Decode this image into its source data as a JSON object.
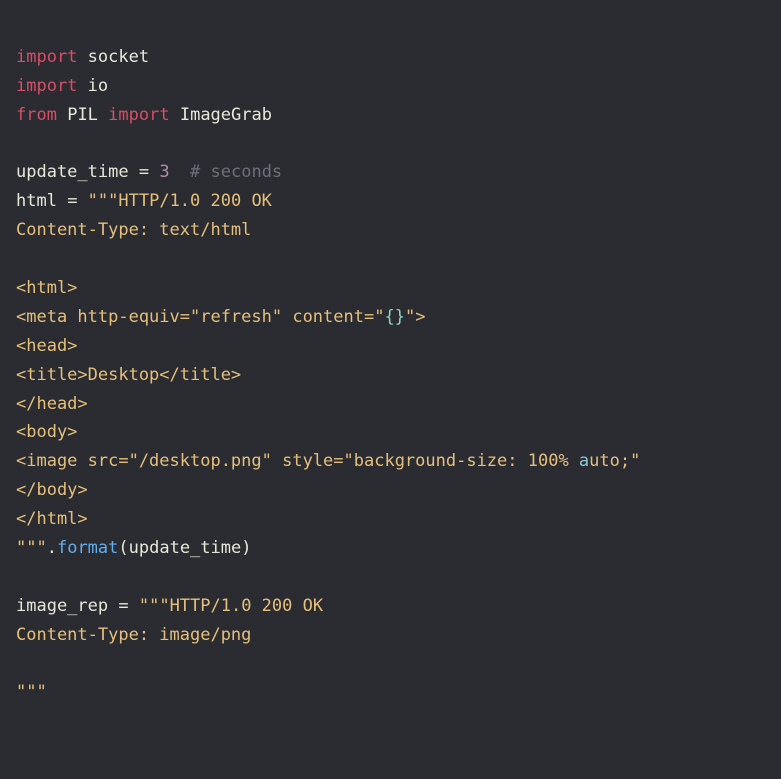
{
  "lines": {
    "l1_kw1": "import",
    "l1_mod": "socket",
    "l2_kw1": "import",
    "l2_mod": "io",
    "l3_kw1": "from",
    "l3_mod": "PIL",
    "l3_kw2": "import",
    "l3_cls": "ImageGrab",
    "l5_var": "update_time",
    "l5_eq": " = ",
    "l5_num": "3",
    "l5_sp": "  ",
    "l5_cm": "# seconds",
    "l6_var": "html",
    "l6_eq": " = ",
    "l6_str_open": "\"\"\"",
    "l6_rest": "HTTP/1.0 200 OK",
    "l7": "Content-Type: text/html",
    "l9": "<html>",
    "l10a": "<meta http-equiv=\"refresh\" content=\"",
    "l10b": "{}",
    "l10c": "\">",
    "l11": "<head>",
    "l12": "<title>Desktop</title>",
    "l13": "</head>",
    "l14": "<body>",
    "l15a": "<image src=\"/desktop.png\" style=\"background-size: 100% ",
    "l15b": "a",
    "l15c": "uto;\"",
    "l16": "</body>",
    "l17": "</html>",
    "l18a": "\"\"\"",
    "l18b": ".",
    "l18c": "format",
    "l18d": "(",
    "l18e": "update_time",
    "l18f": ")",
    "l20_var": "image_rep",
    "l20_eq": " = ",
    "l20_open": "\"\"\"",
    "l20_rest": "HTTP/1.0 200 OK",
    "l21": "Content-Type: image/png",
    "l23": "\"\"\""
  },
  "code_plaintext": "import socket\nimport io\nfrom PIL import ImageGrab\n\nupdate_time = 3  # seconds\nhtml = \"\"\"HTTP/1.0 200 OK\nContent-Type: text/html\n\n<html>\n<meta http-equiv=\"refresh\" content=\"{}\">\n<head>\n<title>Desktop</title>\n</head>\n<body>\n<image src=\"/desktop.png\" style=\"background-size: 100% auto;\"\n</body>\n</html>\n\"\"\".format(update_time)\n\nimage_rep = \"\"\"HTTP/1.0 200 OK\nContent-Type: image/png\n\n\"\"\""
}
